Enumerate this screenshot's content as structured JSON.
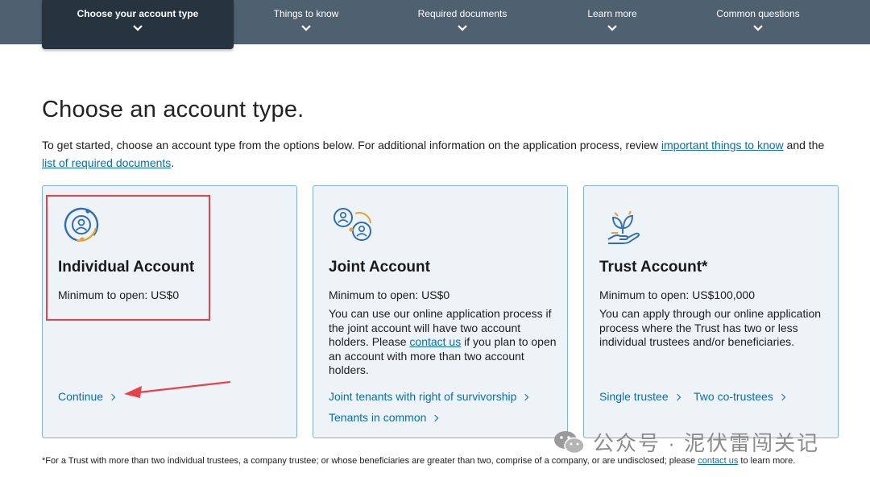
{
  "nav": {
    "items": [
      {
        "label": "Choose your account type",
        "active": true
      },
      {
        "label": "Things to know",
        "active": false
      },
      {
        "label": "Required documents",
        "active": false
      },
      {
        "label": "Learn more",
        "active": false
      },
      {
        "label": "Common questions",
        "active": false
      }
    ]
  },
  "page": {
    "title": "Choose an account type.",
    "intro_text": "To get started, choose an account type from the options below. For additional information on the application process, review ",
    "intro_link1": "important things to know",
    "intro_mid": " and the ",
    "intro_link2": "list of required documents",
    "intro_end": "."
  },
  "cards": [
    {
      "icon": "individual-person-icon",
      "title": "Individual Account",
      "minimum": "Minimum to open: US$0",
      "actions": [
        "Continue"
      ]
    },
    {
      "icon": "joint-people-icon",
      "title": "Joint Account",
      "minimum": "Minimum to open: US$0",
      "desc_pre": "You can use our online application process if the joint account will have two account holders. Please ",
      "desc_link": "contact us",
      "desc_post": " if you plan to open an account with more than two account holders.",
      "actions": [
        "Joint tenants with right of survivorship",
        "Tenants in common"
      ]
    },
    {
      "icon": "plant-in-hand-icon",
      "title": "Trust Account*",
      "minimum": "Minimum to open: US$100,000",
      "desc": "You can apply through our online application process where the Trust has two or less individual trustees and/or beneficiaries.",
      "actions": [
        "Single trustee",
        "Two co-trustees"
      ]
    }
  ],
  "footnote": {
    "text": "*For a Trust with more than two individual trustees, a company trustee; or whose beneficiaries are greater than two, comprise of a company, or are undisclosed; please ",
    "link": "contact us",
    "end": " to learn more."
  },
  "watermark": {
    "text": "公众号 · 泥伏雷闯关记"
  },
  "colors": {
    "nav_bg": "#4f6170",
    "nav_active": "#27333e",
    "link": "#0b6ea5",
    "card_bg": "#eef3f8",
    "card_border": "#7fb2d6",
    "annotation": "#e8414b"
  }
}
